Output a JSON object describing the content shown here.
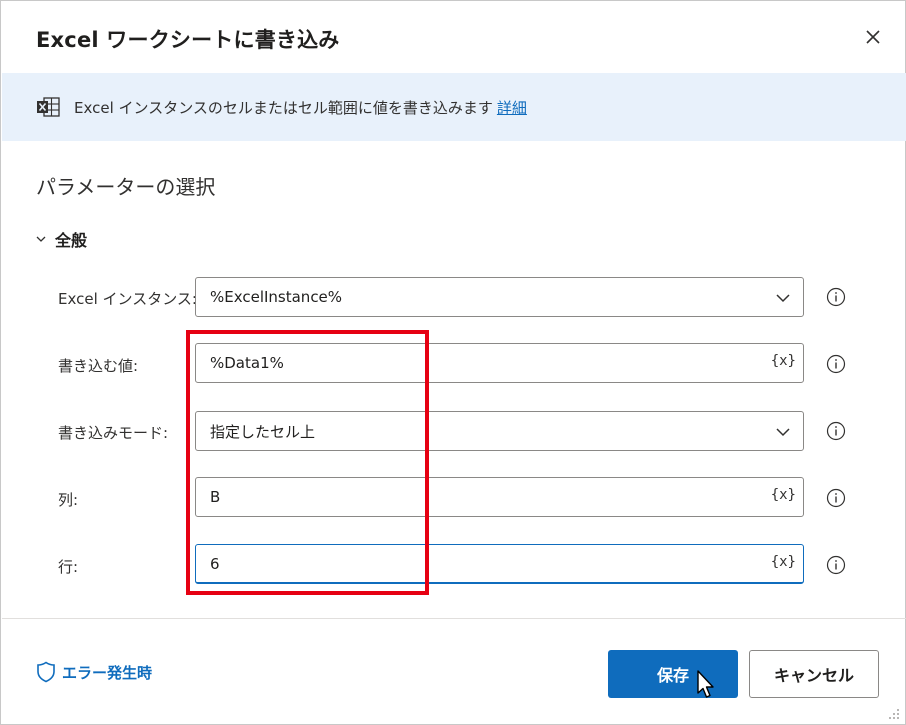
{
  "dialog": {
    "title": "Excel ワークシートに書き込み",
    "close_icon": "close-icon"
  },
  "info": {
    "icon": "excel-icon",
    "text": "Excel インスタンスのセルまたはセル範囲に値を書き込みます",
    "link": "詳細"
  },
  "section": {
    "title": "パラメーターの選択"
  },
  "group": {
    "label": "全般",
    "icon": "chevron-down-icon"
  },
  "fields": {
    "instance": {
      "label": "Excel インスタンス:",
      "value": "%ExcelInstance%"
    },
    "value": {
      "label": "書き込む値:",
      "value": "%Data1%",
      "var_button": "{x}"
    },
    "mode": {
      "label": "書き込みモード:",
      "value": "指定したセル上"
    },
    "column": {
      "label": "列:",
      "value": "B",
      "var_button": "{x}"
    },
    "row": {
      "label": "行:",
      "value": "6",
      "var_button": "{x}"
    }
  },
  "footer": {
    "error_label": "エラー発生時",
    "save_label": "保存",
    "cancel_label": "キャンセル"
  },
  "colors": {
    "accent": "#0f6cbd",
    "info_bg": "#e8f1fb",
    "highlight": "#e60012"
  }
}
